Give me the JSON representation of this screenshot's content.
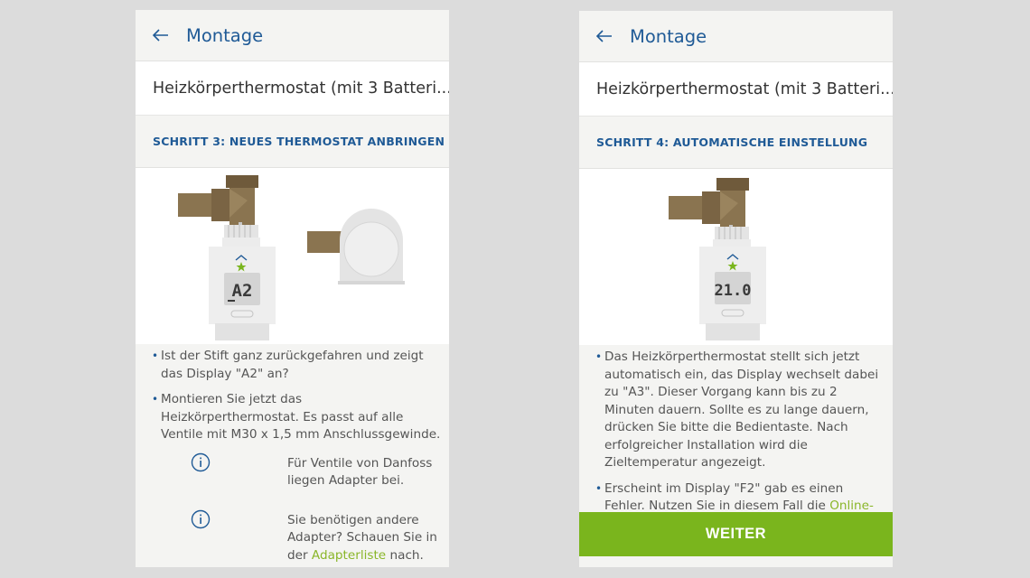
{
  "screens": [
    {
      "header_title": "Montage",
      "product_title": "Heizkörperthermostat (mit 3 Batteri...",
      "step_title": "SCHRITT 3: NEUES THERMOSTAT ANBRINGEN",
      "display_value": "A2",
      "bullets": [
        "Ist der Stift ganz zurückgefahren und zeigt das Display \"A2\" an?",
        "Montieren Sie jetzt das Heizkörperthermostat. Es passt auf alle Ventile mit M30 x 1,5 mm Anschlussgewinde."
      ],
      "notes": [
        {
          "icon": "info-icon",
          "text": "Für Ventile von Danfoss liegen Adapter bei."
        },
        {
          "icon": "info-icon",
          "text_before": "Sie benötigen andere Adapter? Schauen Sie in der ",
          "link": "Adapterliste",
          "text_after": " nach."
        }
      ]
    },
    {
      "header_title": "Montage",
      "product_title": "Heizkörperthermostat (mit 3 Batteri...",
      "step_title": "SCHRITT 4: AUTOMATISCHE EINSTELLUNG",
      "display_value": "21.0",
      "bullets": [
        "Das Heizkörperthermostat stellt sich jetzt automatisch ein, das Display wechselt dabei zu \"A3\". Dieser Vorgang kann bis zu 2 Minuten dauern. Sollte es zu lange dauern, drücken Sie bitte die Bedientaste. Nach erfolgreicher Installation wird die Zieltemperatur angezeigt."
      ],
      "bullet2_before": "Erscheint im Display \"F2\" gab es einen Fehler. Nutzen Sie in diesem Fall die ",
      "bullet2_link": "Online-Hilfe",
      "bullet2_after": ".",
      "button_label": "WEITER"
    }
  ],
  "colors": {
    "accent_blue": "#1f5a96",
    "accent_green": "#7ab51d",
    "link_green": "#8ab629"
  }
}
